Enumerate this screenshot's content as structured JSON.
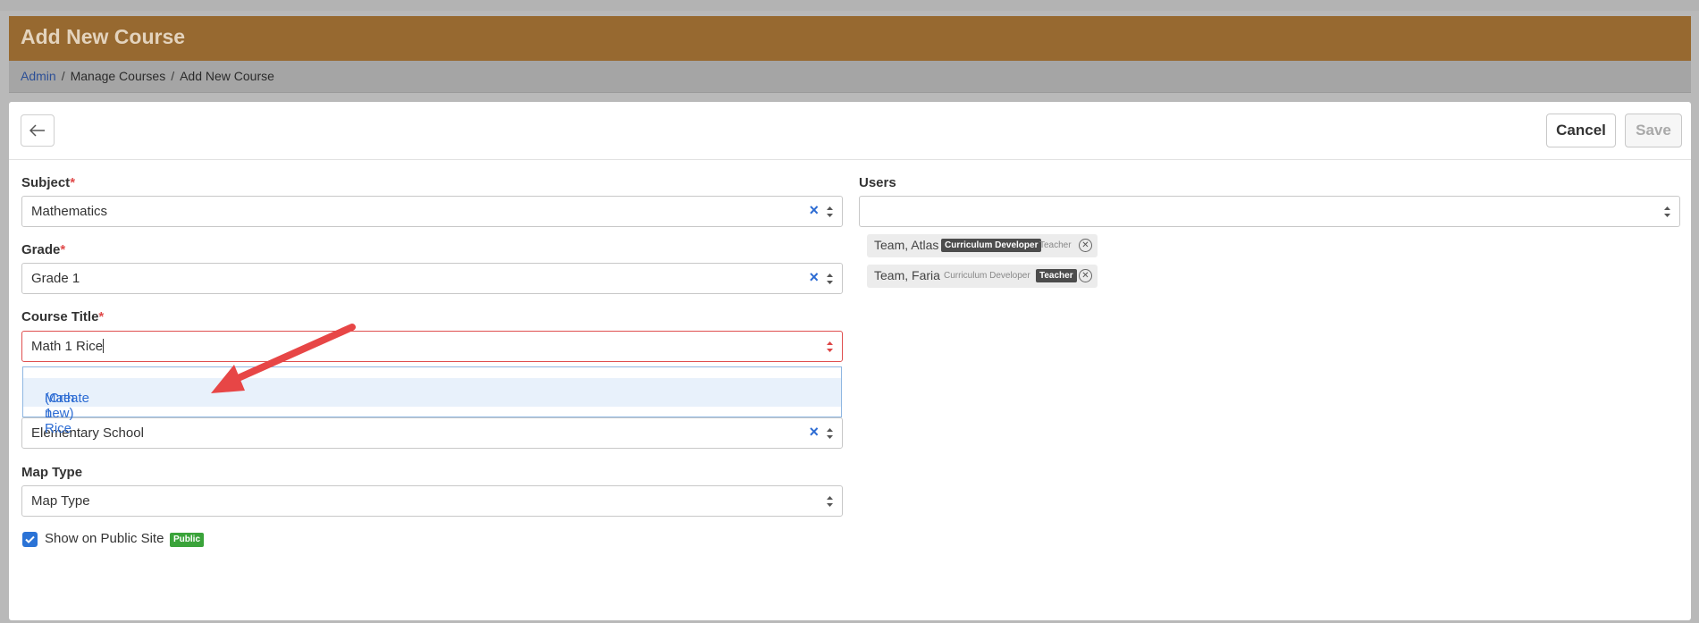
{
  "header": {
    "title": "Add New Course"
  },
  "breadcrumb": {
    "items": [
      "Admin",
      "Manage Courses",
      "Add New Course"
    ]
  },
  "toolbar": {
    "back_icon": "arrow-left-icon",
    "cancel_label": "Cancel",
    "save_label": "Save"
  },
  "form": {
    "subject": {
      "label": "Subject",
      "value": "Mathematics"
    },
    "grade": {
      "label": "Grade",
      "value": "Grade 1"
    },
    "course_title": {
      "label": "Course Title",
      "value": "Math 1 Rice"
    },
    "school": {
      "value": "Elementary School"
    },
    "map_type": {
      "label": "Map Type",
      "placeholder": "Map Type"
    },
    "public": {
      "label": "Show on Public Site",
      "badge": "Public",
      "checked": true
    },
    "required_marker": "*",
    "clear_symbol": "×"
  },
  "dropdown": {
    "option_name": "Math 1 Rice",
    "option_action": "(Create new)"
  },
  "users": {
    "label": "Users",
    "chips": [
      {
        "name": "Team, Atlas",
        "role1": "Curriculum Developer",
        "role2": "Teacher",
        "active": "role1"
      },
      {
        "name": "Team, Faria",
        "role1": "Curriculum Developer",
        "role2": "Teacher",
        "active": "role2"
      }
    ]
  },
  "colors": {
    "header_bg": "#976930",
    "accent": "#2d6cd3",
    "error": "#df4f4f",
    "annotation_arrow": "#e74646",
    "public_badge": "#3aa33a"
  }
}
